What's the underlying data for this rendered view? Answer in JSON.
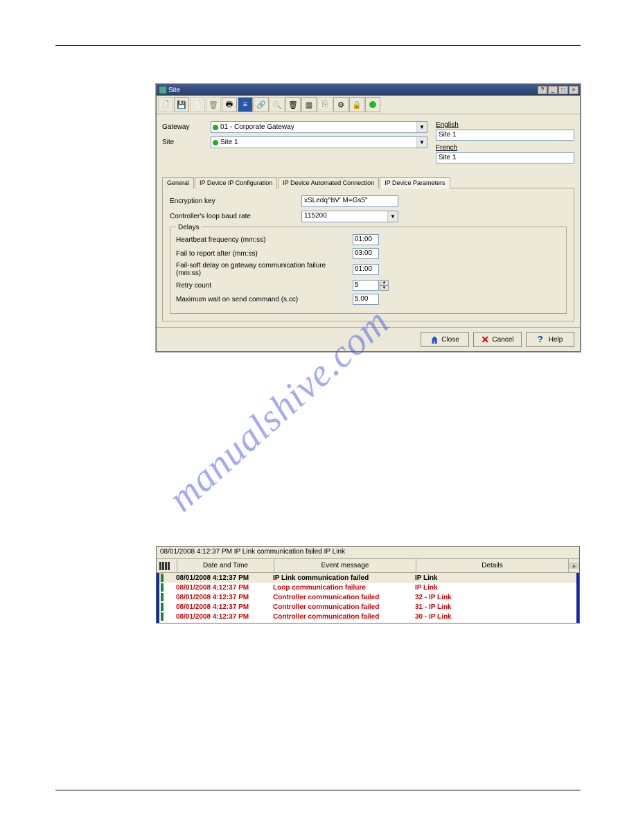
{
  "window": {
    "title": "Site",
    "gateway_label": "Gateway",
    "gateway_value": "01 - Corporate Gateway",
    "site_label": "Site",
    "site_value": "Site 1",
    "lang_en_label": "English",
    "lang_en_value": "Site 1",
    "lang_fr_label": "French",
    "lang_fr_value": "Site 1",
    "tabs": {
      "general": "General",
      "ipconf": "IP Device IP Configuration",
      "auto": "IP Device Automated Connection",
      "params": "IP Device Parameters"
    },
    "encryption_label": "Encryption key",
    "encryption_value": "xSLedq^bV' M=Gs5\"",
    "baud_label": "Controller's loop baud rate",
    "baud_value": "115200",
    "delays_legend": "Delays",
    "heartbeat_label": "Heartbeat frequency (mm:ss)",
    "heartbeat_value": "01:00",
    "failreport_label": "Fail to report after (mm:ss)",
    "failreport_value": "03:00",
    "failsoft_label": "Fail-soft delay on gateway communication failure (mm:ss)",
    "failsoft_value": "01:00",
    "retry_label": "Retry count",
    "retry_value": "5",
    "maxwait_label": "Maximum wait on send command (s.cc)",
    "maxwait_value": "5.00",
    "btn_close": "Close",
    "btn_cancel": "Cancel",
    "btn_help": "Help"
  },
  "log": {
    "status": "08/01/2008 4:12:37 PM  IP Link communication failed IP Link",
    "header_datetime": "Date and Time",
    "header_message": "Event message",
    "header_details": "Details",
    "rows": [
      {
        "dt": "08/01/2008 4:12:37 PM",
        "msg": "IP Link communication failed",
        "det": "IP Link",
        "sel": true,
        "color": "black"
      },
      {
        "dt": "08/01/2008 4:12:37 PM",
        "msg": "Loop communication failure",
        "det": "IP Link",
        "sel": false,
        "color": "red"
      },
      {
        "dt": "08/01/2008 4:12:37 PM",
        "msg": "Controller communication failed",
        "det": "32 - IP Link",
        "sel": false,
        "color": "red"
      },
      {
        "dt": "08/01/2008 4:12:37 PM",
        "msg": "Controller communication failed",
        "det": "31 - IP Link",
        "sel": false,
        "color": "red"
      },
      {
        "dt": "08/01/2008 4:12:37 PM",
        "msg": "Controller communication failed",
        "det": "30 - IP Link",
        "sel": false,
        "color": "red"
      }
    ]
  },
  "watermark": "manualshive.com"
}
